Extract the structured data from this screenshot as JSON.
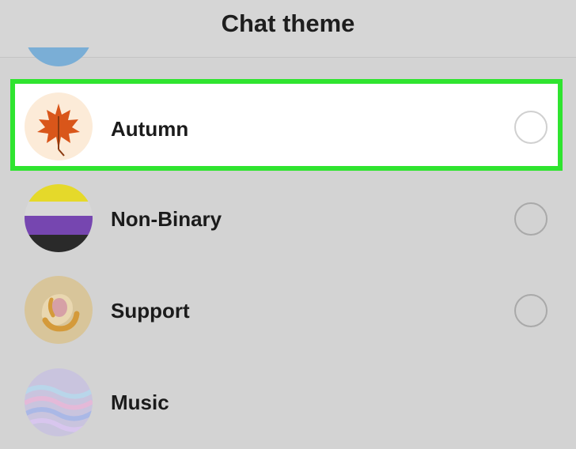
{
  "header": {
    "title": "Chat theme"
  },
  "themes": [
    {
      "label": "Autumn",
      "selected": true,
      "icon": "maple-leaf-icon"
    },
    {
      "label": "Non-Binary",
      "selected": false,
      "icon": "non-binary-flag-icon",
      "colors": [
        "#e5d92a",
        "#7646b0",
        "#2a2a2a",
        "#f3f3f3"
      ]
    },
    {
      "label": "Support",
      "selected": false,
      "icon": "support-hands-icon"
    },
    {
      "label": "Music",
      "selected": false,
      "icon": "music-wave-icon"
    }
  ],
  "highlight_color": "#2fe42f"
}
